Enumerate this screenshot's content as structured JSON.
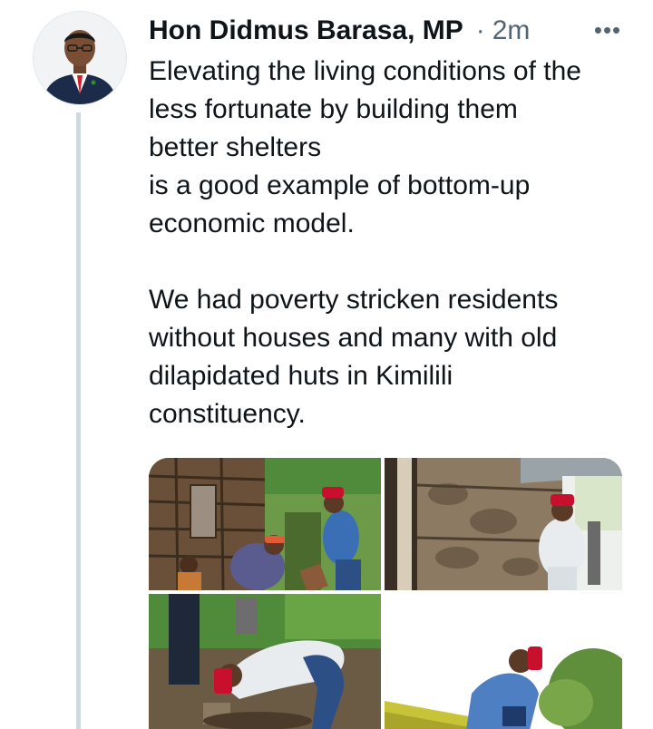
{
  "tweet": {
    "author_name": "Hon Didmus Barasa, MP",
    "separator": "·",
    "timestamp": "2m",
    "more_label": "•••",
    "paragraphs": [
      [
        "Elevating the living conditions of the",
        "less fortunate by building them",
        "better shelters",
        "is a good example of bottom-up",
        "economic model."
      ],
      [
        "We had poverty stricken residents",
        "without houses and many with old",
        "dilapidated huts in Kimilili",
        "constituency."
      ]
    ]
  },
  "media": {
    "count": 4,
    "items": [
      {
        "icon": "photo-mud-hut-with-residents"
      },
      {
        "icon": "photo-mp-by-mud-wall"
      },
      {
        "icon": "photo-mp-digging-foundation"
      },
      {
        "icon": "photo-mp-on-roof"
      }
    ]
  },
  "colors": {
    "text": "#0f1419",
    "muted": "#536471",
    "thread_line": "#cfd9de",
    "accent_red_cap": "#c8102e"
  }
}
